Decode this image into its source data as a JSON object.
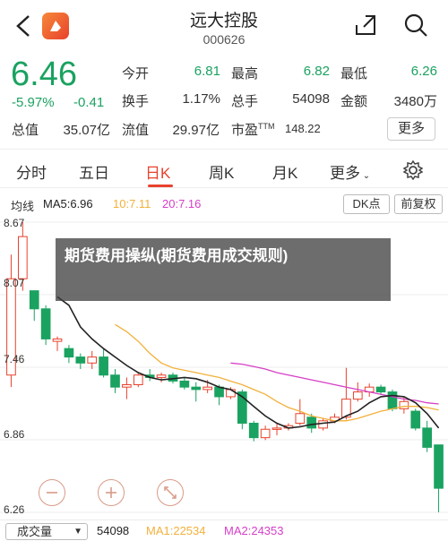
{
  "header": {
    "title": "远大控股",
    "code": "000626"
  },
  "quote": {
    "price": "6.46",
    "change_pct": "-5.97%",
    "change": "-0.41",
    "open_label": "今开",
    "open": "6.81",
    "high_label": "最高",
    "high": "6.82",
    "low_label": "最低",
    "low": "6.26",
    "turnover_label": "换手",
    "turnover": "1.17%",
    "volume_label": "总手",
    "volume": "54098",
    "amount_label": "金额",
    "amount": "3480万",
    "mktcap_label": "总值",
    "mktcap": "35.07亿",
    "float_label": "流值",
    "float": "29.97亿",
    "pe_label": "市盈",
    "pe_sup": "TTM",
    "pe": "148.22",
    "more_label": "更多"
  },
  "tabs": [
    "分时",
    "五日",
    "日K",
    "周K",
    "月K",
    "更多"
  ],
  "active_tab": "日K",
  "ma": {
    "label": "均线",
    "ma5": "MA5:6.96",
    "ma10": "10:7.11",
    "ma20": "20:7.16",
    "dk_label": "DK点",
    "fq_label": "前复权"
  },
  "y_axis": [
    "8.67",
    "8.07",
    "7.46",
    "6.86",
    "6.26"
  ],
  "overlay_text": "期货费用操纵(期货费用成交规则)",
  "volume_bar": {
    "selector": "成交量",
    "value": "54098",
    "ma1": "MA1:22534",
    "ma2": "MA2:24353"
  },
  "colors": {
    "up": "#e8412c",
    "down": "#1aa260",
    "ma5": "#222222",
    "ma10": "#f2b13c",
    "ma20": "#d63fc7"
  },
  "chart_data": {
    "type": "candlestick",
    "ylim": [
      6.26,
      8.67
    ],
    "candles": [
      {
        "o": 7.4,
        "c": 8.2,
        "h": 8.4,
        "l": 7.3
      },
      {
        "o": 8.2,
        "c": 8.55,
        "h": 8.67,
        "l": 8.1
      },
      {
        "o": 8.1,
        "c": 7.95,
        "h": 8.1,
        "l": 7.85
      },
      {
        "o": 7.95,
        "c": 7.7,
        "h": 7.98,
        "l": 7.65
      },
      {
        "o": 7.68,
        "c": 7.7,
        "h": 7.72,
        "l": 7.6
      },
      {
        "o": 7.62,
        "c": 7.55,
        "h": 7.65,
        "l": 7.5
      },
      {
        "o": 7.55,
        "c": 7.5,
        "h": 7.58,
        "l": 7.45
      },
      {
        "o": 7.5,
        "c": 7.55,
        "h": 7.6,
        "l": 7.45
      },
      {
        "o": 7.55,
        "c": 7.4,
        "h": 7.62,
        "l": 7.38
      },
      {
        "o": 7.4,
        "c": 7.3,
        "h": 7.45,
        "l": 7.25
      },
      {
        "o": 7.3,
        "c": 7.32,
        "h": 7.38,
        "l": 7.2
      },
      {
        "o": 7.32,
        "c": 7.4,
        "h": 7.42,
        "l": 7.3
      },
      {
        "o": 7.4,
        "c": 7.38,
        "h": 7.45,
        "l": 7.35
      },
      {
        "o": 7.38,
        "c": 7.4,
        "h": 7.42,
        "l": 7.34
      },
      {
        "o": 7.4,
        "c": 7.35,
        "h": 7.42,
        "l": 7.33
      },
      {
        "o": 7.35,
        "c": 7.3,
        "h": 7.38,
        "l": 7.28
      },
      {
        "o": 7.3,
        "c": 7.28,
        "h": 7.34,
        "l": 7.18
      },
      {
        "o": 7.28,
        "c": 7.3,
        "h": 7.36,
        "l": 7.25
      },
      {
        "o": 7.3,
        "c": 7.22,
        "h": 7.32,
        "l": 7.15
      },
      {
        "o": 7.22,
        "c": 7.28,
        "h": 7.3,
        "l": 7.2
      },
      {
        "o": 7.26,
        "c": 7.0,
        "h": 7.28,
        "l": 6.95
      },
      {
        "o": 7.0,
        "c": 6.88,
        "h": 7.02,
        "l": 6.85
      },
      {
        "o": 6.88,
        "c": 6.95,
        "h": 6.98,
        "l": 6.86
      },
      {
        "o": 6.95,
        "c": 6.96,
        "h": 7.0,
        "l": 6.9
      },
      {
        "o": 6.96,
        "c": 6.98,
        "h": 7.0,
        "l": 6.94
      },
      {
        "o": 7.0,
        "c": 7.08,
        "h": 7.2,
        "l": 6.98
      },
      {
        "o": 7.05,
        "c": 6.96,
        "h": 7.08,
        "l": 6.92
      },
      {
        "o": 6.96,
        "c": 7.02,
        "h": 7.04,
        "l": 6.94
      },
      {
        "o": 7.02,
        "c": 7.05,
        "h": 7.08,
        "l": 7.0
      },
      {
        "o": 7.05,
        "c": 7.2,
        "h": 7.46,
        "l": 7.03
      },
      {
        "o": 7.2,
        "c": 7.26,
        "h": 7.34,
        "l": 7.18
      },
      {
        "o": 7.26,
        "c": 7.3,
        "h": 7.33,
        "l": 7.22
      },
      {
        "o": 7.3,
        "c": 7.26,
        "h": 7.32,
        "l": 7.24
      },
      {
        "o": 7.26,
        "c": 7.12,
        "h": 7.28,
        "l": 7.1
      },
      {
        "o": 7.12,
        "c": 7.18,
        "h": 7.22,
        "l": 7.08
      },
      {
        "o": 7.1,
        "c": 6.96,
        "h": 7.12,
        "l": 6.94
      },
      {
        "o": 6.96,
        "c": 6.8,
        "h": 7.02,
        "l": 6.76
      },
      {
        "o": 6.82,
        "c": 6.46,
        "h": 6.82,
        "l": 6.26
      }
    ],
    "ma5": [
      null,
      null,
      null,
      null,
      8.05,
      7.98,
      7.8,
      7.7,
      7.62,
      7.55,
      7.48,
      7.42,
      7.38,
      7.36,
      7.37,
      7.38,
      7.37,
      7.34,
      7.3,
      7.28,
      7.22,
      7.14,
      7.06,
      7.0,
      6.96,
      6.97,
      6.99,
      7.0,
      7.01,
      7.06,
      7.1,
      7.17,
      7.22,
      7.23,
      7.22,
      7.17,
      7.08,
      6.96
    ],
    "ma10": [
      null,
      null,
      null,
      null,
      null,
      null,
      null,
      null,
      null,
      7.82,
      7.76,
      7.68,
      7.58,
      7.5,
      7.46,
      7.44,
      7.42,
      7.4,
      7.38,
      7.35,
      7.32,
      7.28,
      7.24,
      7.18,
      7.13,
      7.1,
      7.06,
      7.04,
      7.02,
      7.02,
      7.04,
      7.07,
      7.1,
      7.12,
      7.14,
      7.14,
      7.13,
      7.11
    ],
    "ma20": [
      null,
      null,
      null,
      null,
      null,
      null,
      null,
      null,
      null,
      null,
      null,
      null,
      null,
      null,
      null,
      null,
      null,
      null,
      null,
      7.5,
      7.49,
      7.47,
      7.45,
      7.42,
      7.4,
      7.38,
      7.36,
      7.34,
      7.32,
      7.3,
      7.28,
      7.26,
      7.24,
      7.22,
      7.2,
      7.19,
      7.17,
      7.16
    ]
  }
}
